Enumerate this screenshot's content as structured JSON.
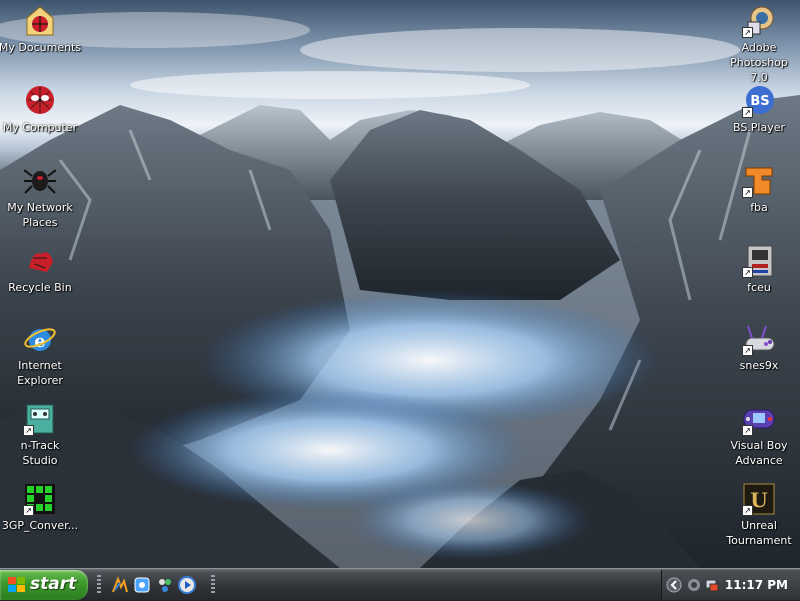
{
  "desktop": {
    "left_icons": [
      {
        "label": "My Documents",
        "icon": "my-documents-icon"
      },
      {
        "label": "My Computer",
        "icon": "my-computer-icon"
      },
      {
        "label": "My Network Places",
        "icon": "network-places-icon"
      },
      {
        "label": "Recycle Bin",
        "icon": "recycle-bin-icon"
      },
      {
        "label": "Internet Explorer",
        "icon": "internet-explorer-icon"
      },
      {
        "label": "n-Track Studio",
        "icon": "ntrack-studio-icon"
      },
      {
        "label": "3GP_Conver...",
        "icon": "3gp-converter-icon"
      }
    ],
    "right_icons": [
      {
        "label": "Adobe Photoshop 7.0",
        "icon": "photoshop-icon"
      },
      {
        "label": "BS.Player",
        "icon": "bsplayer-icon"
      },
      {
        "label": "fba",
        "icon": "fba-icon"
      },
      {
        "label": "fceu",
        "icon": "fceu-icon"
      },
      {
        "label": "snes9x",
        "icon": "snes9x-icon"
      },
      {
        "label": "Visual Boy Advance",
        "icon": "visualboy-icon"
      },
      {
        "label": "Unreal Tournament",
        "icon": "unreal-tournament-icon"
      }
    ]
  },
  "taskbar": {
    "start_label": "start",
    "quick_launch": [
      "winamp-icon",
      "media-icon",
      "messenger-icon",
      "media-player-icon"
    ],
    "clock": "11:17 PM"
  },
  "colors": {
    "start_green": "#3e9b2c",
    "taskbar_dark": "#33363a",
    "label_text": "#ffffff"
  }
}
